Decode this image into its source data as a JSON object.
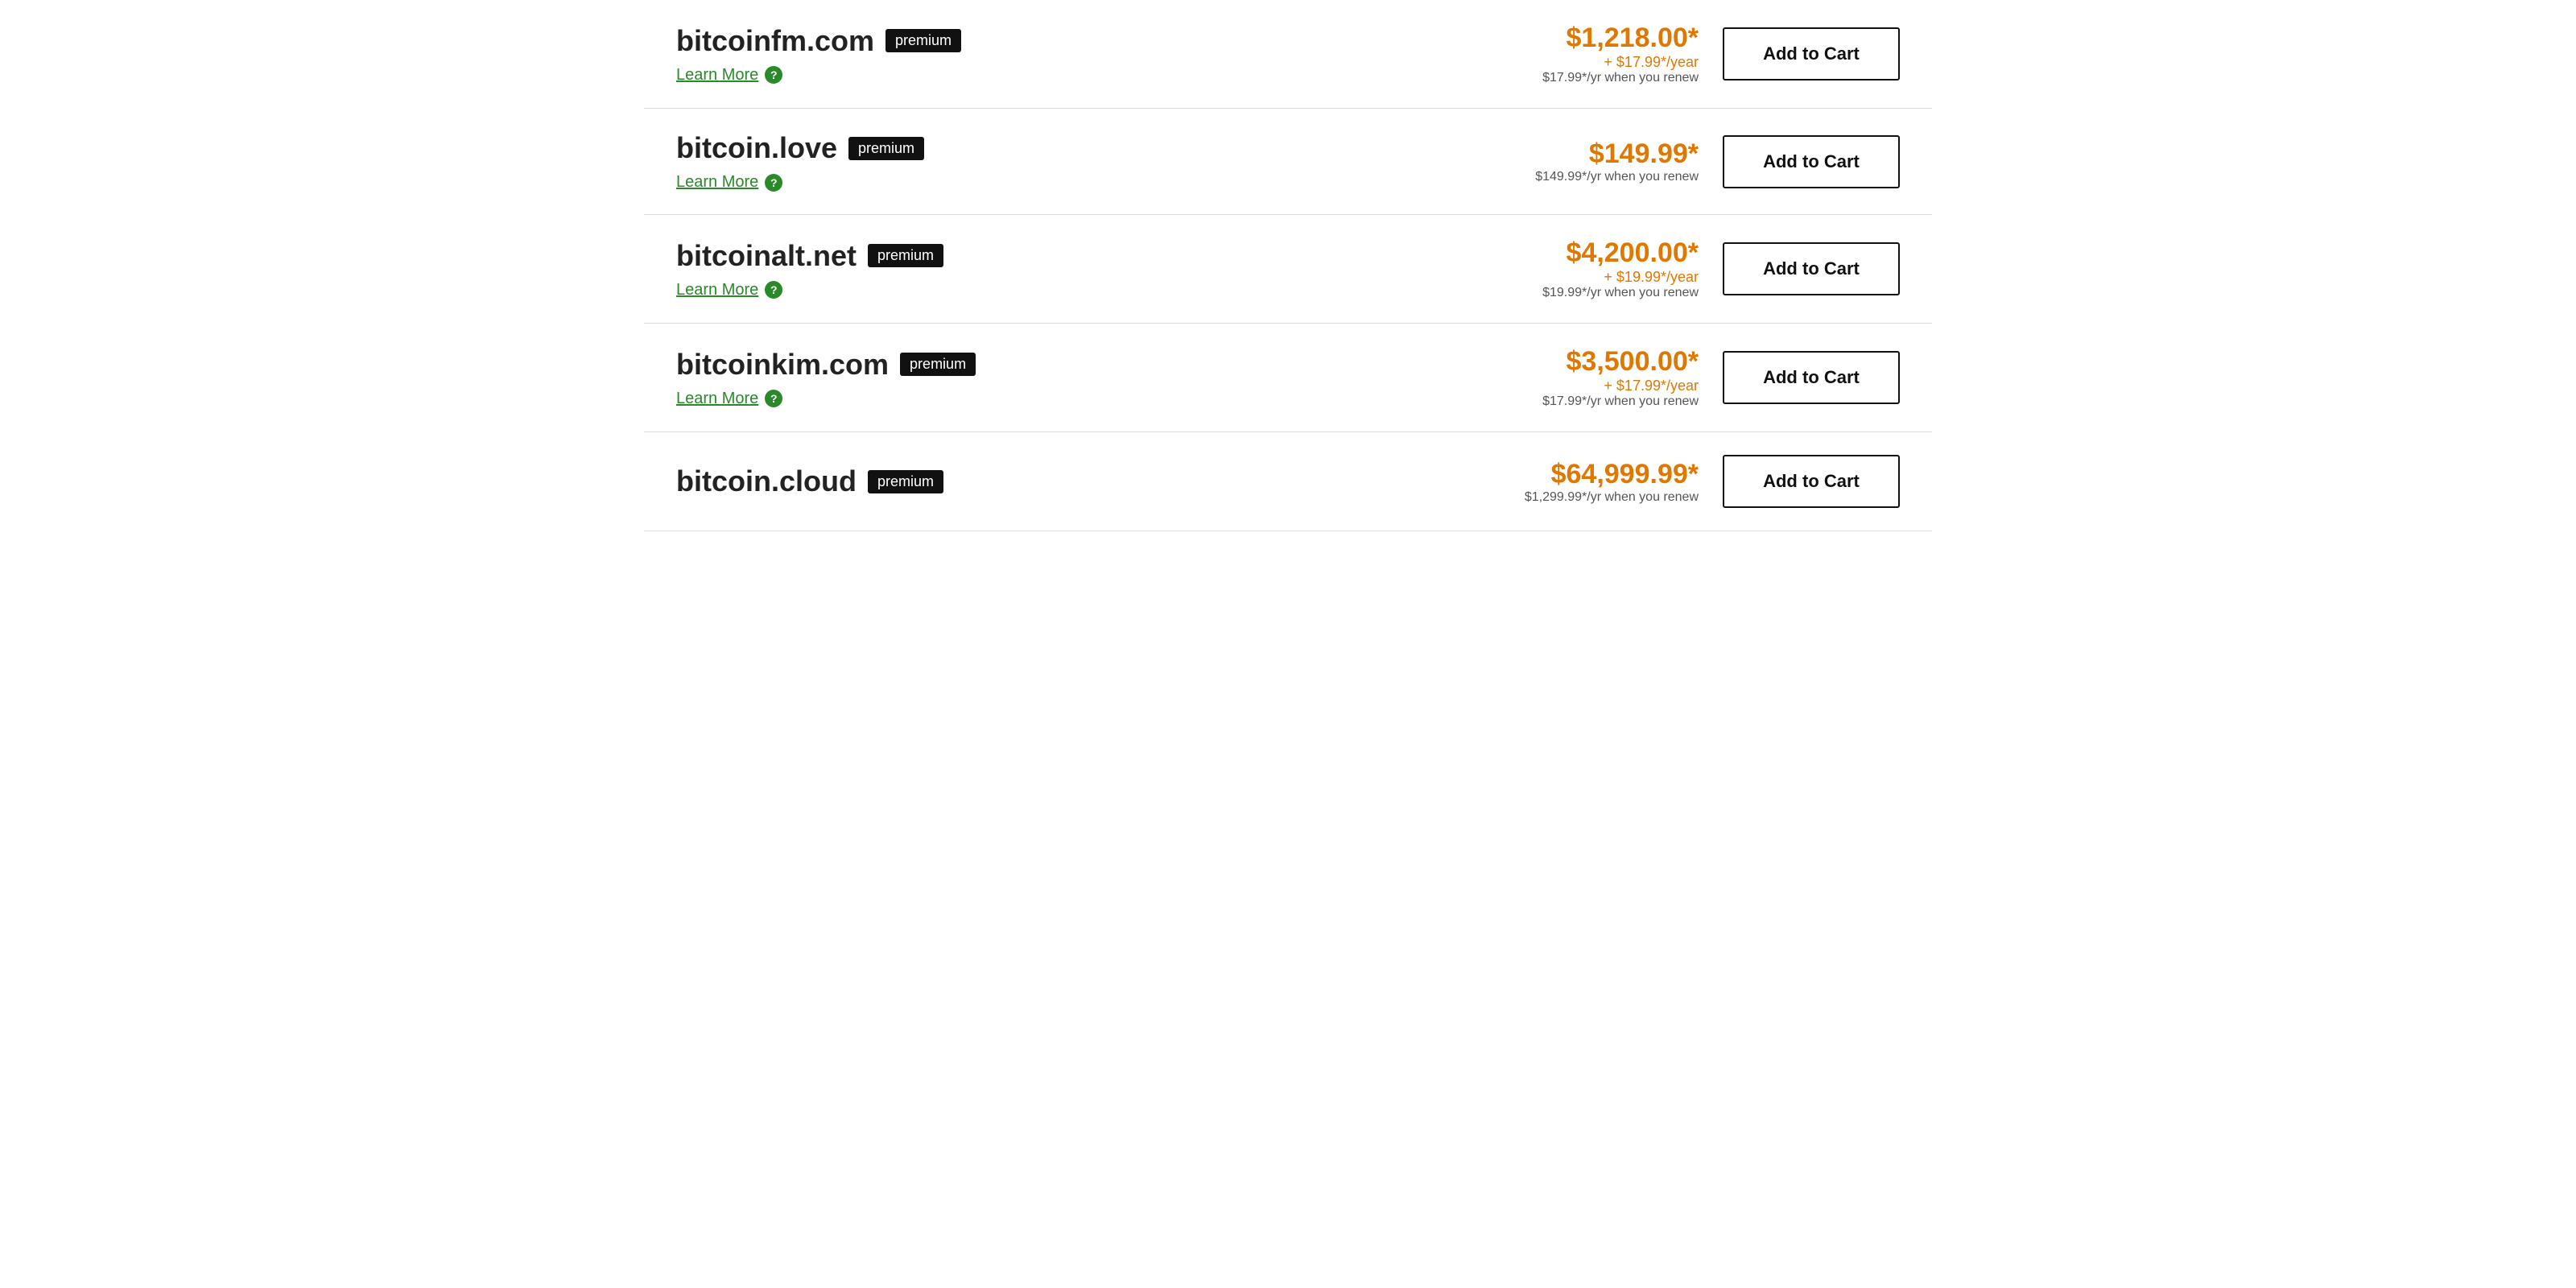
{
  "domains": [
    {
      "id": "bitcoinfm",
      "name": "bitcoinfm.com",
      "badge": "premium",
      "learn_more": "Learn More",
      "price_main": "$1,218.00*",
      "price_per_year": "+ $17.99*/year",
      "price_renew": "$17.99*/yr when you renew",
      "add_to_cart": "Add to Cart"
    },
    {
      "id": "bitcoinlove",
      "name": "bitcoin.love",
      "badge": "premium",
      "learn_more": "Learn More",
      "price_main": "$149.99*",
      "price_per_year": null,
      "price_renew": "$149.99*/yr when you renew",
      "add_to_cart": "Add to Cart"
    },
    {
      "id": "bitcoinaltnet",
      "name": "bitcoinalt.net",
      "badge": "premium",
      "learn_more": "Learn More",
      "price_main": "$4,200.00*",
      "price_per_year": "+ $19.99*/year",
      "price_renew": "$19.99*/yr when you renew",
      "add_to_cart": "Add to Cart"
    },
    {
      "id": "bitcoinkimcom",
      "name": "bitcoinkim.com",
      "badge": "premium",
      "learn_more": "Learn More",
      "price_main": "$3,500.00*",
      "price_per_year": "+ $17.99*/year",
      "price_renew": "$17.99*/yr when you renew",
      "add_to_cart": "Add to Cart"
    },
    {
      "id": "bitcoincloud",
      "name": "bitcoin.cloud",
      "badge": "premium",
      "learn_more": null,
      "price_main": "$64,999.99*",
      "price_per_year": null,
      "price_renew": "$1,299.99*/yr when you renew",
      "add_to_cart": "Add to Cart"
    }
  ],
  "icons": {
    "help": "?"
  }
}
